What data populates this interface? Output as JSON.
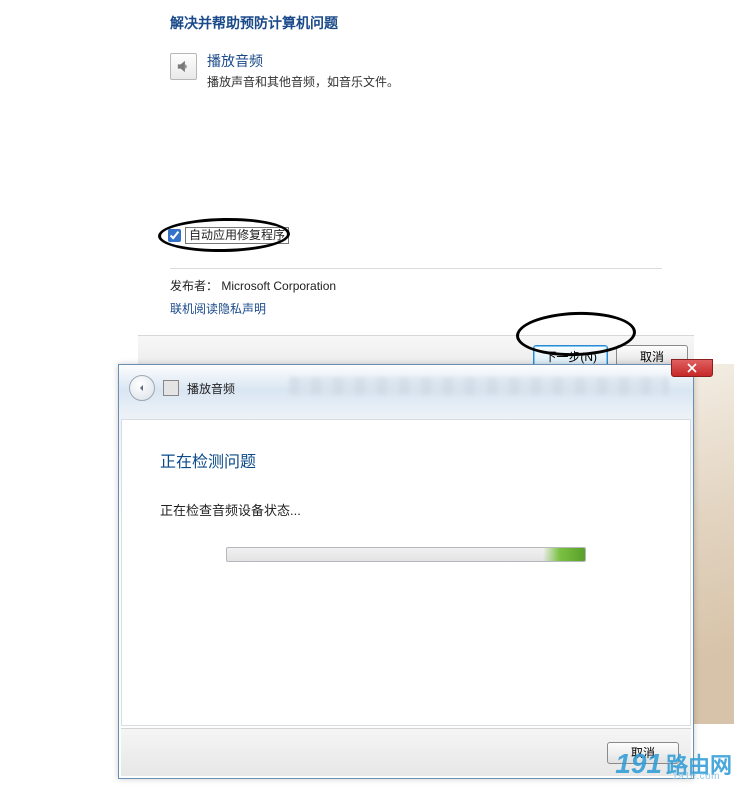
{
  "top": {
    "category_heading": "解决并帮助预防计算机问题",
    "item_title": "播放音频",
    "item_desc": "播放声音和其他音频，如音乐文件。"
  },
  "dialog1": {
    "checkbox_label": "自动应用修复程序",
    "publisher_prefix": "发布者：",
    "publisher_name": "Microsoft Corporation",
    "privacy_link": "联机阅读隐私声明",
    "next_btn": "下一步(N)",
    "cancel_btn": "取消"
  },
  "dialog2": {
    "window_title": "播放音频",
    "heading": "正在检测问题",
    "status": "正在检查音频设备状态...",
    "cancel_btn": "取消"
  },
  "watermark": {
    "num": "191",
    "text": "路由网",
    "sub": "191e.com"
  }
}
